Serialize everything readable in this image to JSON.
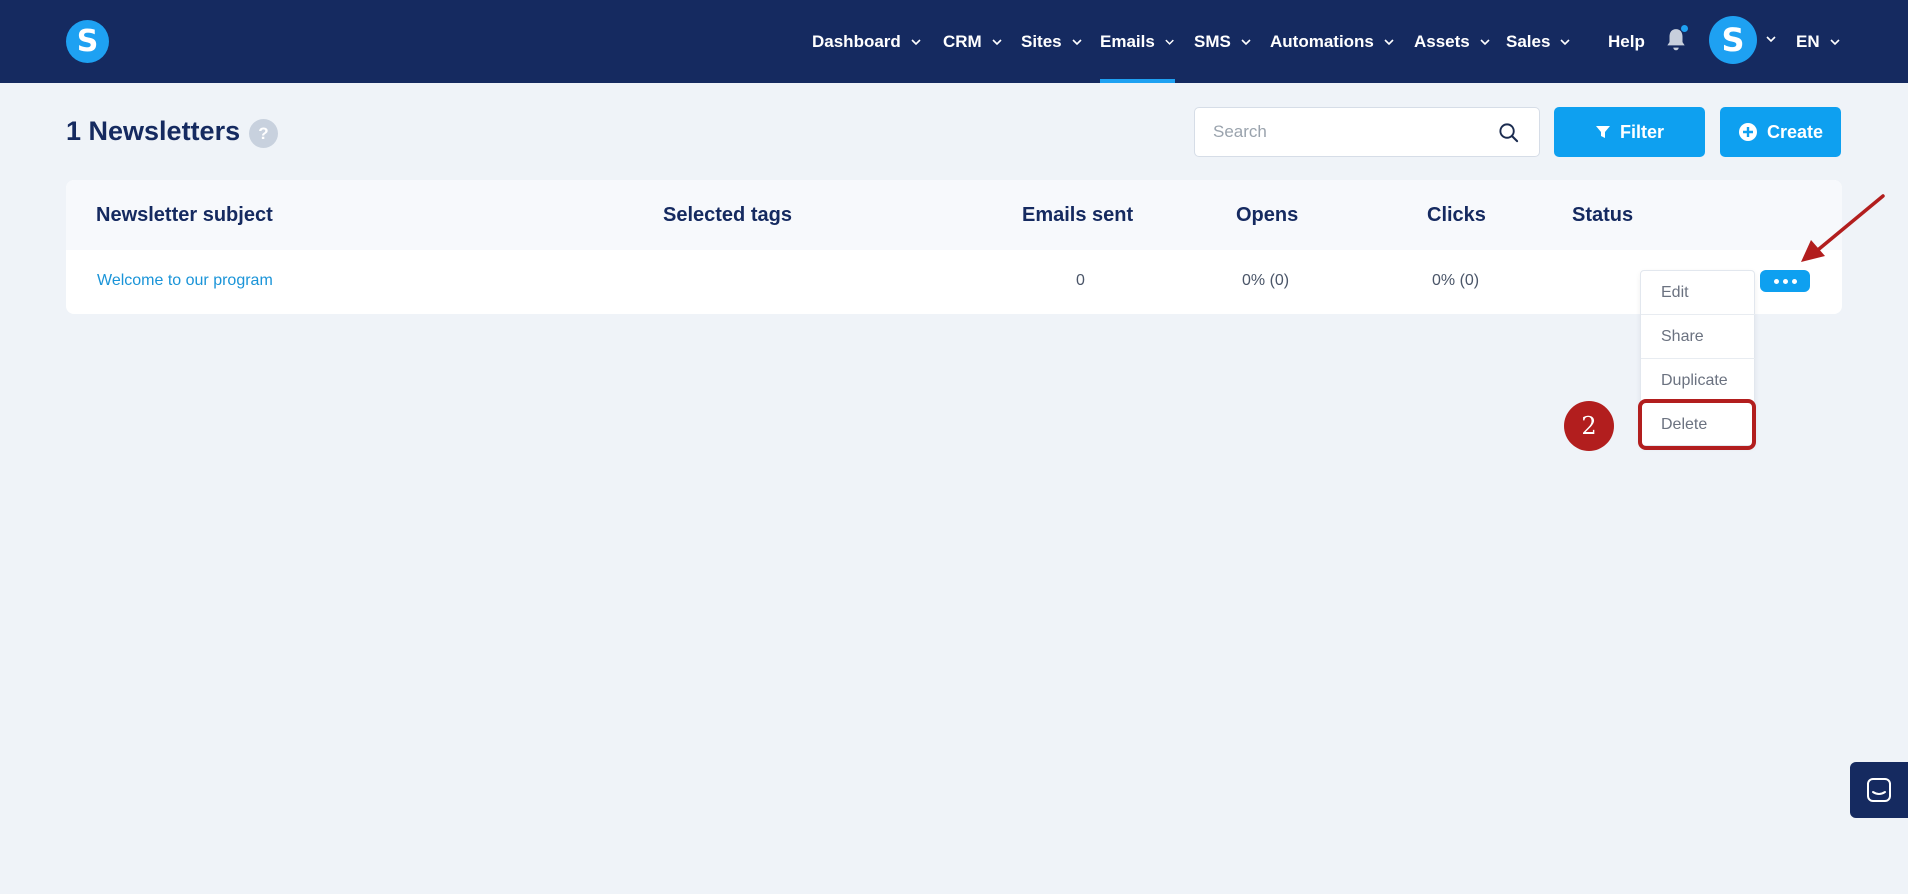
{
  "nav": {
    "items": [
      {
        "label": "Dashboard",
        "dropdown": true
      },
      {
        "label": "CRM",
        "dropdown": true
      },
      {
        "label": "Sites",
        "dropdown": true
      },
      {
        "label": "Emails",
        "dropdown": true,
        "active": true
      },
      {
        "label": "SMS",
        "dropdown": true
      },
      {
        "label": "Automations",
        "dropdown": true
      },
      {
        "label": "Assets",
        "dropdown": true
      },
      {
        "label": "Sales",
        "dropdown": true
      },
      {
        "label": "Help",
        "dropdown": false
      }
    ],
    "logo_letter": "S",
    "avatar_letter": "S",
    "language": "EN",
    "notification_dot": true
  },
  "page": {
    "title": "1 Newsletters",
    "help_symbol": "?"
  },
  "search": {
    "placeholder": "Search",
    "value": ""
  },
  "toolbar": {
    "filter_label": "Filter",
    "create_label": "Create"
  },
  "table": {
    "headers": [
      "Newsletter subject",
      "Selected tags",
      "Emails sent",
      "Opens",
      "Clicks",
      "Status"
    ],
    "rows": [
      {
        "subject": "Welcome to our program",
        "tags": "",
        "emails_sent": "0",
        "opens": "0% (0)",
        "clicks": "0% (0)",
        "status": ""
      }
    ]
  },
  "row_menu": {
    "items": [
      "Edit",
      "Share",
      "Duplicate",
      "Delete"
    ]
  },
  "annotation": {
    "step_number": "2",
    "highlight_color": "#b21e1e"
  },
  "colors": {
    "nav_bg": "#152a60",
    "accent": "#0ea0f0",
    "page_bg": "#eff3f8",
    "link": "#1a94d8"
  },
  "icons": {
    "logo": "brand-s-icon",
    "notifications": "bell-icon",
    "search": "search-icon",
    "filter": "funnel-icon",
    "create": "plus-circle-icon",
    "more": "ellipsis-icon",
    "chat": "chat-icon"
  }
}
